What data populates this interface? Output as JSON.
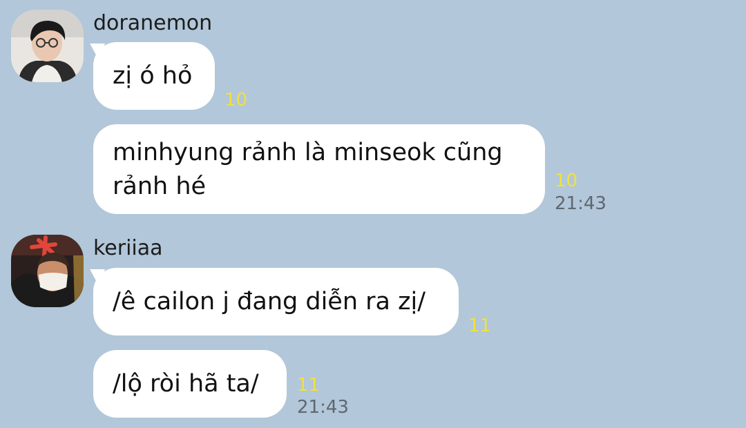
{
  "messages": [
    {
      "sender": "doranemon",
      "avatar_icon": "profile-photo-young-man-glasses",
      "bubbles": [
        {
          "text": "zị ó hỏ",
          "unread": "10",
          "time": ""
        },
        {
          "text_lines": [
            "minhyung rảnh là minseok cũng",
            "rảnh hé"
          ],
          "unread": "10",
          "time": "21:43"
        }
      ]
    },
    {
      "sender": "keriiaa",
      "avatar_icon": "profile-photo-masked-person",
      "bubbles": [
        {
          "text": "/ê cailon j đang diễn ra zị/",
          "unread": "11",
          "time": ""
        },
        {
          "text": "/lộ ròi hã ta/",
          "unread": "11",
          "time": "21:43"
        }
      ]
    }
  ],
  "colors": {
    "background": "#b2c7d9",
    "bubble": "#ffffff",
    "unread_count": "#f2e13b",
    "timestamp": "#5e6770"
  }
}
